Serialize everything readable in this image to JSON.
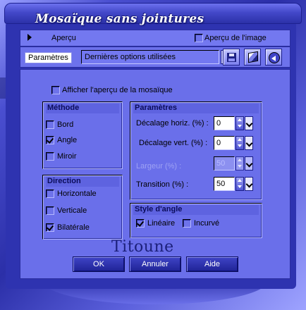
{
  "window": {
    "title": "Mosaïque sans jointures"
  },
  "preview": {
    "label": "Aperçu",
    "image_preview_label": "Aperçu de l'image",
    "image_preview_checked": false
  },
  "parameters_bar": {
    "label": "Paramètres",
    "preset_value": "Dernières options utilisées"
  },
  "show_mosaic_preview": {
    "label": "Afficher l'aperçu de la mosaïque",
    "checked": false
  },
  "method": {
    "title": "Méthode",
    "options": [
      {
        "label": "Bord",
        "checked": false
      },
      {
        "label": "Angle",
        "checked": true
      },
      {
        "label": "Miroir",
        "checked": false
      }
    ]
  },
  "direction": {
    "title": "Direction",
    "options": [
      {
        "label": "Horizontale",
        "checked": false
      },
      {
        "label": "Verticale",
        "checked": false
      },
      {
        "label": "Bilatérale",
        "checked": true
      }
    ]
  },
  "params": {
    "title": "Paramètres",
    "fields": [
      {
        "label": "Décalage horiz. (%) :",
        "value": "0",
        "enabled": true
      },
      {
        "label": "Décalage vert. (%) :",
        "value": "0",
        "enabled": true
      },
      {
        "label": "Largeur (%) :",
        "value": "50",
        "enabled": false
      },
      {
        "label": "Transition (%) :",
        "value": "50",
        "enabled": true
      }
    ]
  },
  "corner_style": {
    "title": "Style d'angle",
    "options": [
      {
        "label": "Linéaire",
        "checked": true
      },
      {
        "label": "Incurvé",
        "checked": false
      }
    ]
  },
  "signature": "Titoune",
  "buttons": {
    "ok": "OK",
    "cancel": "Annuler",
    "help": "Aide"
  },
  "colors": {
    "panel": "#6a6fea",
    "accent": "#2b2fa8",
    "button": "#1f2396"
  }
}
